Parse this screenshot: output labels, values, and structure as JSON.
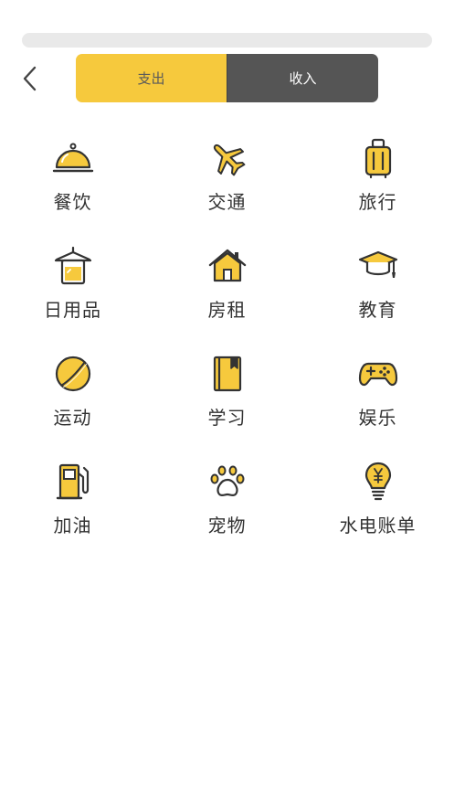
{
  "colors": {
    "accent": "#f6c93d",
    "dark": "#555555",
    "text": "#333333"
  },
  "header": {
    "back_icon": "chevron-left-icon",
    "tabs": [
      {
        "label": "支出",
        "selected": true
      },
      {
        "label": "收入",
        "selected": false
      }
    ]
  },
  "categories": [
    {
      "label": "餐饮",
      "icon": "food-cloche-icon"
    },
    {
      "label": "交通",
      "icon": "airplane-icon"
    },
    {
      "label": "旅行",
      "icon": "luggage-icon"
    },
    {
      "label": "日用品",
      "icon": "towel-rack-icon"
    },
    {
      "label": "房租",
      "icon": "house-icon"
    },
    {
      "label": "教育",
      "icon": "graduation-cap-icon"
    },
    {
      "label": "运动",
      "icon": "ball-icon"
    },
    {
      "label": "学习",
      "icon": "book-icon"
    },
    {
      "label": "娱乐",
      "icon": "gamepad-icon"
    },
    {
      "label": "加油",
      "icon": "fuel-pump-icon"
    },
    {
      "label": "宠物",
      "icon": "paw-icon"
    },
    {
      "label": "水电账单",
      "icon": "lightbulb-icon"
    }
  ]
}
